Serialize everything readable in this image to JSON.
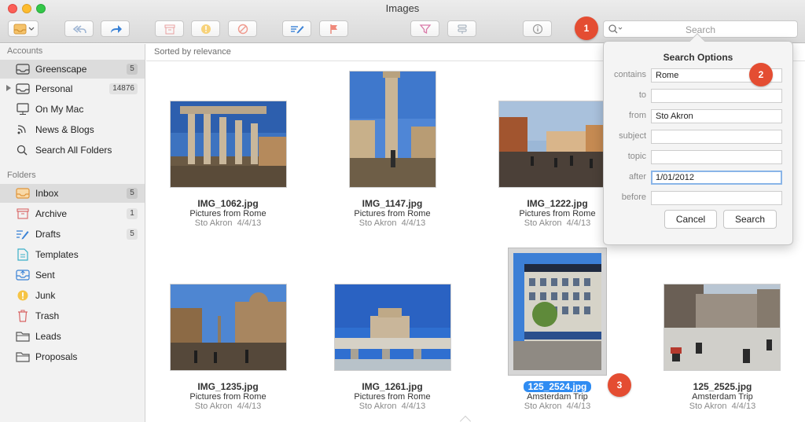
{
  "window": {
    "title": "Images"
  },
  "colors": {
    "callout": "#e44d32",
    "selection_blue": "#2f8cf2",
    "sidebar_bg": "#f2f2f2"
  },
  "toolbar": {
    "buttons": [
      {
        "name": "mailbox-menu",
        "icon": "inbox-dropdown-icon"
      },
      {
        "name": "reply",
        "icon": "reply-all-icon"
      },
      {
        "name": "forward",
        "icon": "forward-arrow-icon"
      },
      {
        "name": "archive",
        "icon": "archive-box-icon"
      },
      {
        "name": "junk",
        "icon": "junk-exclamation-icon"
      },
      {
        "name": "block",
        "icon": "block-circle-icon"
      },
      {
        "name": "compose",
        "icon": "compose-icon"
      },
      {
        "name": "flag",
        "icon": "flag-icon"
      },
      {
        "name": "filter",
        "icon": "filter-funnel-icon"
      },
      {
        "name": "rules",
        "icon": "rules-icon"
      },
      {
        "name": "info",
        "icon": "info-icon"
      }
    ],
    "search_placeholder": "Search"
  },
  "callouts": [
    "1",
    "2",
    "3"
  ],
  "sidebar": {
    "accounts_label": "Accounts",
    "accounts": [
      {
        "label": "Greenscape",
        "count": "5",
        "icon": "inbox-tray-icon",
        "selected": true
      },
      {
        "label": "Personal",
        "count": "14876",
        "icon": "inbox-tray-icon",
        "disclosure": true
      },
      {
        "label": "On My Mac",
        "count": "",
        "icon": "computer-icon"
      },
      {
        "label": "News & Blogs",
        "count": "",
        "icon": "rss-icon"
      },
      {
        "label": "Search All Folders",
        "count": "",
        "icon": "search-icon"
      }
    ],
    "folders_label": "Folders",
    "folders": [
      {
        "label": "Inbox",
        "count": "5",
        "icon": "inbox-icon",
        "selected": true
      },
      {
        "label": "Archive",
        "count": "1",
        "icon": "archive-icon"
      },
      {
        "label": "Drafts",
        "count": "5",
        "icon": "drafts-icon"
      },
      {
        "label": "Templates",
        "count": "",
        "icon": "templates-icon"
      },
      {
        "label": "Sent",
        "count": "",
        "icon": "sent-icon"
      },
      {
        "label": "Junk",
        "count": "",
        "icon": "junk-icon"
      },
      {
        "label": "Trash",
        "count": "",
        "icon": "trash-icon"
      },
      {
        "label": "Leads",
        "count": "",
        "icon": "folder-icon"
      },
      {
        "label": "Proposals",
        "count": "",
        "icon": "folder-icon"
      }
    ]
  },
  "main": {
    "sort_label": "Sorted by relevance",
    "items": [
      {
        "filename": "IMG_1062.jpg",
        "folder": "Pictures from Rome",
        "sender": "Sto Akron",
        "date": "4/4/13",
        "scene": "ruins-columns"
      },
      {
        "filename": "IMG_1147.jpg",
        "folder": "Pictures from Rome",
        "sender": "Sto Akron",
        "date": "4/4/13",
        "scene": "tall-column"
      },
      {
        "filename": "IMG_1222.jpg",
        "folder": "Pictures from Rome",
        "sender": "Sto Akron",
        "date": "4/4/13",
        "scene": "piazza-dusk"
      },
      {
        "filename": "IMG_1235.jpg",
        "folder": "Pictures from Rome",
        "sender": "Sto Akron",
        "date": "4/4/13",
        "scene": "fountain-square"
      },
      {
        "filename": "IMG_1261.jpg",
        "folder": "Pictures from Rome",
        "sender": "Sto Akron",
        "date": "4/4/13",
        "scene": "castle-bridge"
      },
      {
        "filename": "125_2524.jpg",
        "folder": "Amsterdam Trip",
        "sender": "Sto Akron",
        "date": "4/4/13",
        "scene": "hotel-building",
        "selected": true
      },
      {
        "filename": "125_2525.jpg",
        "folder": "Amsterdam Trip",
        "sender": "Sto Akron",
        "date": "4/4/13",
        "scene": "plaza-people"
      }
    ]
  },
  "search_options": {
    "title": "Search Options",
    "fields": [
      {
        "label": "contains",
        "value": "Rome"
      },
      {
        "label": "to",
        "value": ""
      },
      {
        "label": "from",
        "value": "Sto Akron"
      },
      {
        "label": "subject",
        "value": ""
      },
      {
        "label": "topic",
        "value": ""
      },
      {
        "label": "after",
        "value": "1/01/2012",
        "focused": true
      },
      {
        "label": "before",
        "value": ""
      }
    ],
    "cancel_label": "Cancel",
    "search_label": "Search"
  }
}
